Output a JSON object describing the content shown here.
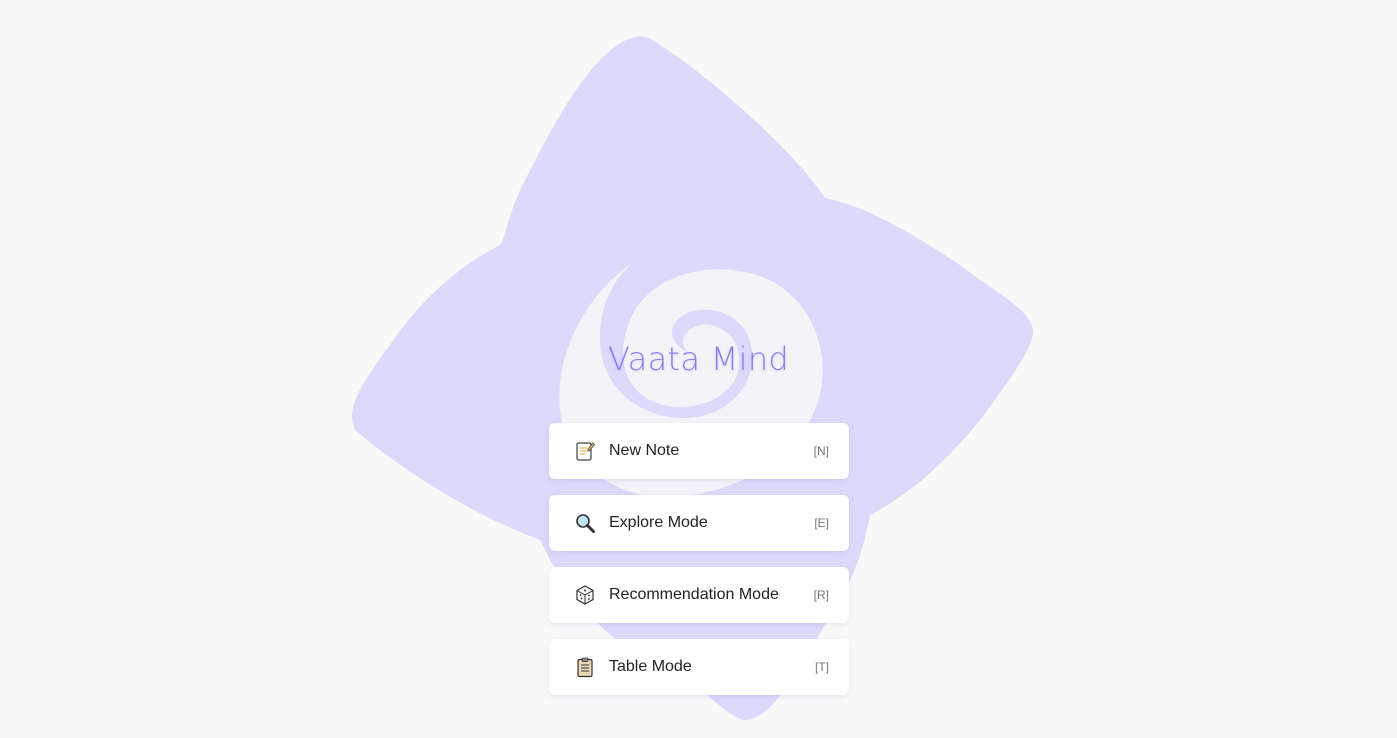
{
  "app": {
    "title": "Vaata Mind"
  },
  "colors": {
    "background": "#f9f9f9",
    "logo_fill": "#dcdafa",
    "accent": "#8b80f0"
  },
  "menu": {
    "items": [
      {
        "icon": "memo-icon",
        "label": "New Note",
        "shortcut": "[N]"
      },
      {
        "icon": "magnifier-icon",
        "label": "Explore Mode",
        "shortcut": "[E]"
      },
      {
        "icon": "dice-icon",
        "label": "Recommendation Mode",
        "shortcut": "[R]"
      },
      {
        "icon": "clipboard-icon",
        "label": "Table Mode",
        "shortcut": "[T]"
      }
    ]
  }
}
